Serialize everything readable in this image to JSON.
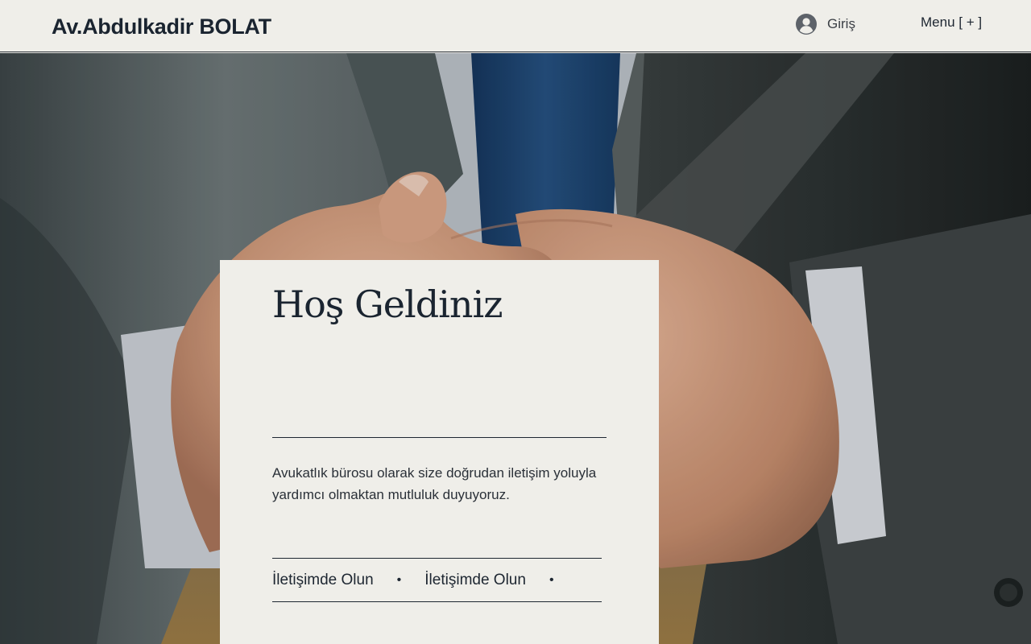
{
  "header": {
    "brand": "Av.Abdulkadir BOLAT",
    "login_label": "Giriş",
    "menu_label": "Menu [ + ]"
  },
  "card": {
    "title": "Hoş Geldiniz",
    "description": "Avukatlık bürosu olarak size doğrudan iletişim yoluyla yardımcı olmaktan mutluluk duyuyoruz.",
    "marquee": [
      "İletişimde Olun",
      "İletişimde Olun"
    ],
    "separator": "•"
  },
  "icons": {
    "login": "user-avatar-icon"
  },
  "colors": {
    "background": "#efeee9",
    "text": "#1a2430",
    "accent_tie": "#1f3f68"
  }
}
